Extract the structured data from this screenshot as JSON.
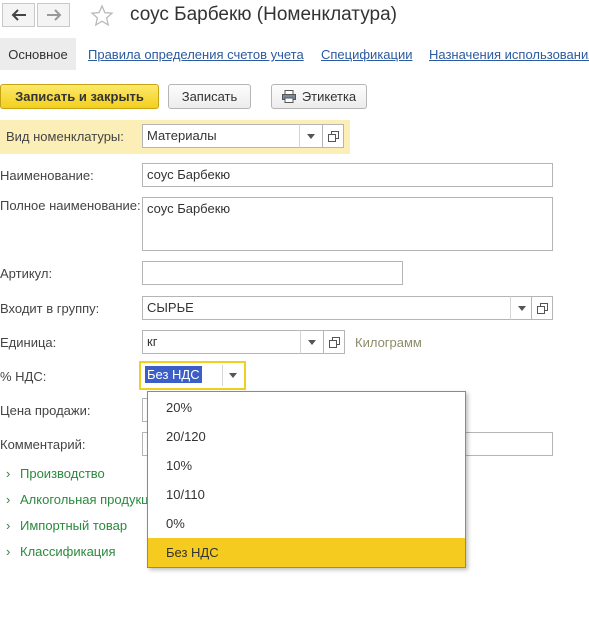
{
  "window": {
    "title": "соус Барбекю (Номенклатура)"
  },
  "icons": {
    "back": "arrow-left-icon",
    "forward": "arrow-right-icon",
    "favorite": "star-icon",
    "print": "printer-icon",
    "dropdown": "chevron-down-icon",
    "open": "open-window-icon",
    "expand": "chevron-right-icon"
  },
  "tabs": [
    {
      "label": "Основное",
      "active": true
    },
    {
      "label": "Правила определения счетов учета"
    },
    {
      "label": "Спецификации"
    },
    {
      "label": "Назначения использования"
    }
  ],
  "toolbar": {
    "save_close": "Записать и закрыть",
    "save": "Записать",
    "label": "Этикетка"
  },
  "form": {
    "kind_label": "Вид номенклатуры:",
    "kind_value": "Материалы",
    "name_label": "Наименование:",
    "name_value": "соус Барбекю",
    "full_name_label": "Полное наименование:",
    "full_name_value": "соус Барбекю",
    "article_label": "Артикул:",
    "article_value": "",
    "group_label": "Входит в группу:",
    "group_value": "СЫРЬЕ",
    "unit_label": "Единица:",
    "unit_value": "кг",
    "unit_hint": "Килограмм",
    "vat_label": "% НДС:",
    "vat_value": "Без НДС",
    "price_label": "Цена продажи:",
    "comment_label": "Комментарий:"
  },
  "groups": [
    {
      "label": "Производство"
    },
    {
      "label": "Алкогольная продукция"
    },
    {
      "label": "Импортный товар"
    },
    {
      "label": "Классификация"
    }
  ],
  "vat_options": [
    {
      "label": "20%"
    },
    {
      "label": "20/120"
    },
    {
      "label": "10%"
    },
    {
      "label": "10/110"
    },
    {
      "label": "0%"
    },
    {
      "label": "Без НДС",
      "selected": true
    }
  ],
  "colors": {
    "accent_yellow": "#f3cf1e",
    "selected_item": "#f6cb1f",
    "link_blue": "#2c5aa0",
    "group_green": "#2a8a3e",
    "highlight_row": "#fbeeb7"
  }
}
